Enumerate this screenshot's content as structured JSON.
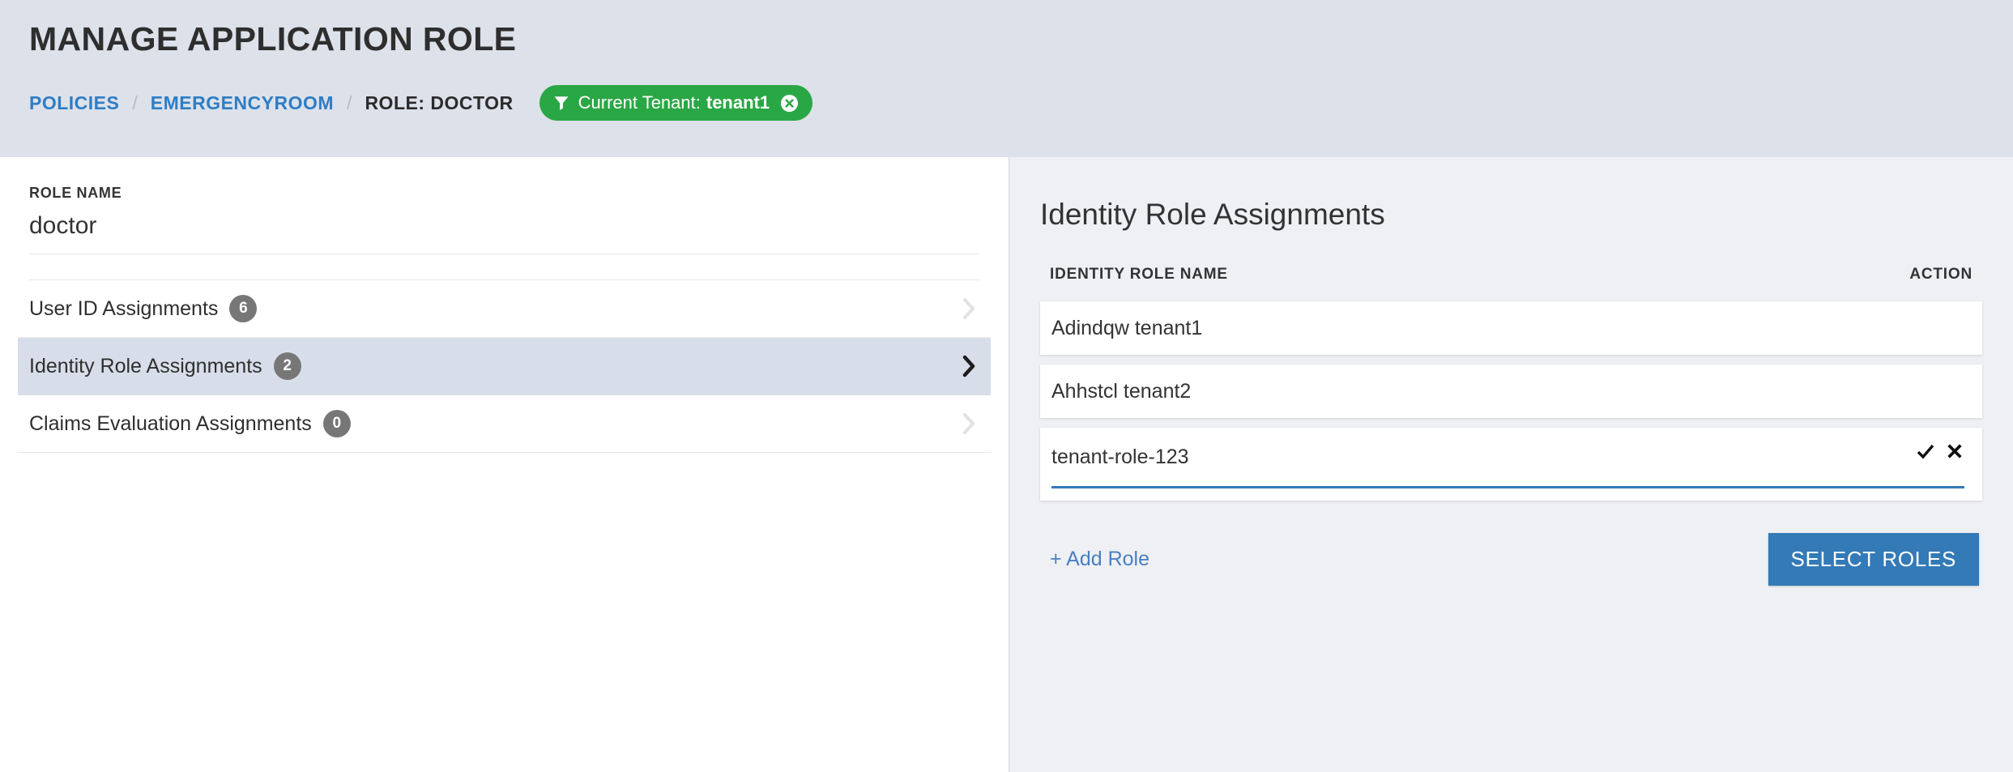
{
  "header": {
    "title": "MANAGE APPLICATION ROLE",
    "breadcrumb": {
      "items": [
        {
          "label": "POLICIES",
          "type": "link"
        },
        {
          "label": "EMERGENCYROOM",
          "type": "link"
        },
        {
          "label": "ROLE: DOCTOR",
          "type": "current"
        }
      ],
      "separator": "/"
    },
    "tenant_badge": {
      "icon": "funnel-icon",
      "prefix": "Current Tenant:",
      "value": "tenant1",
      "close_icon": "circle-close-icon",
      "color": "#2aa745"
    }
  },
  "left_panel": {
    "role_name_label": "ROLE NAME",
    "role_name_value": "doctor",
    "nav_items": [
      {
        "label": "User ID Assignments",
        "count": "6",
        "selected": false
      },
      {
        "label": "Identity Role Assignments",
        "count": "2",
        "selected": true
      },
      {
        "label": "Claims Evaluation Assignments",
        "count": "0",
        "selected": false
      }
    ]
  },
  "right_panel": {
    "title": "Identity Role Assignments",
    "columns": {
      "name": "IDENTITY ROLE NAME",
      "action": "ACTION"
    },
    "rows": [
      {
        "name": "Adindqw tenant1",
        "editing": false
      },
      {
        "name": "Ahhstcl tenant2",
        "editing": false
      },
      {
        "name": "tenant-role-123",
        "editing": true,
        "confirm_icon": "check-icon",
        "cancel_icon": "x-icon"
      }
    ],
    "add_role_label": "+ Add Role",
    "select_roles_label": "SELECT ROLES",
    "accent_color": "#337ab7"
  }
}
